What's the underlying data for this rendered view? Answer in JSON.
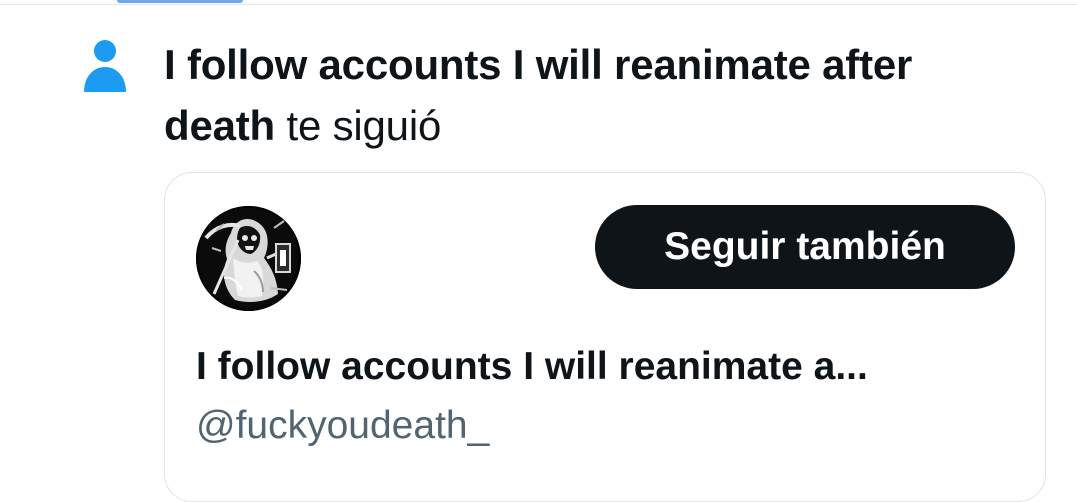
{
  "notification": {
    "type": "follow",
    "icon": "person-icon",
    "actor_name": "I follow accounts I will reanimate after death",
    "action_text": "te siguió",
    "accent_color": "#1d9bf0"
  },
  "profile_card": {
    "avatar": "grim-reaper-avatar",
    "follow_button_label": "Seguir también",
    "display_name": "I follow accounts I will reanimate a...",
    "handle": "@fuckyoudeath_"
  }
}
